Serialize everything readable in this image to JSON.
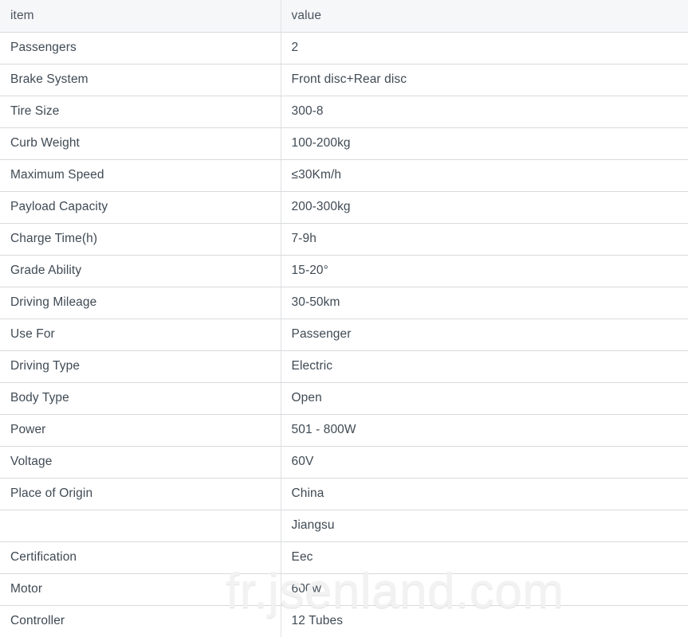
{
  "table": {
    "headers": {
      "item": "item",
      "value": "value"
    },
    "rows": [
      {
        "item": "Passengers",
        "value": "2"
      },
      {
        "item": "Brake System",
        "value": "Front disc+Rear disc"
      },
      {
        "item": "Tire Size",
        "value": "300-8"
      },
      {
        "item": "Curb Weight",
        "value": "100-200kg"
      },
      {
        "item": "Maximum Speed",
        "value": "≤30Km/h"
      },
      {
        "item": "Payload Capacity",
        "value": "200-300kg"
      },
      {
        "item": "Charge Time(h)",
        "value": "7-9h"
      },
      {
        "item": "Grade Ability",
        "value": "15-20°"
      },
      {
        "item": "Driving Mileage",
        "value": "30-50km"
      },
      {
        "item": "Use For",
        "value": "Passenger"
      },
      {
        "item": "Driving Type",
        "value": "Electric"
      },
      {
        "item": "Body Type",
        "value": "Open"
      },
      {
        "item": "Power",
        "value": "501 - 800W"
      },
      {
        "item": "Voltage",
        "value": "60V"
      },
      {
        "item": "Place of Origin",
        "value": "China"
      },
      {
        "item": "",
        "value": "Jiangsu"
      },
      {
        "item": "Certification",
        "value": "Eec"
      },
      {
        "item": "Motor",
        "value": "600w"
      },
      {
        "item": "Controller",
        "value": "12 Tubes"
      }
    ]
  },
  "watermark": {
    "text": "fr.jsenland.com",
    "color": "#f2f2f2"
  },
  "colors": {
    "header_background": "#f6f7f9",
    "border": "#d8dadd",
    "text": "#3f4a54",
    "page_background": "#ffffff"
  }
}
